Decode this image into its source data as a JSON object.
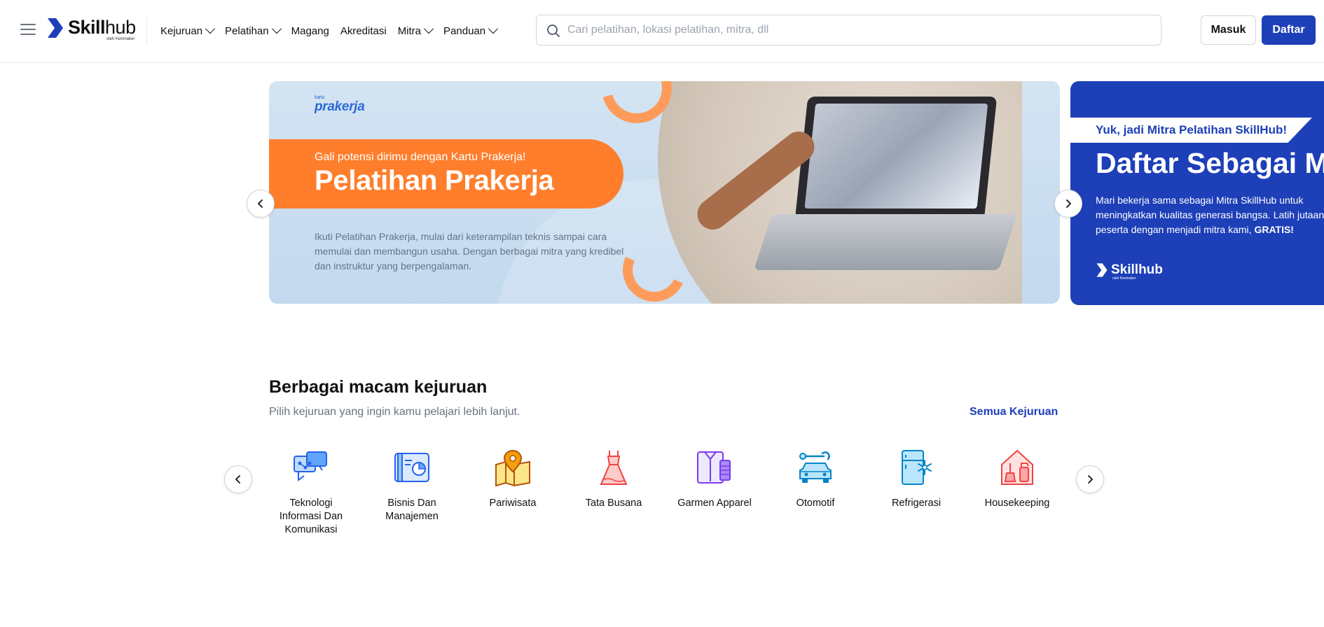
{
  "header": {
    "logo_text_bold": "Skill",
    "logo_text_light": "hub",
    "logo_sub": "oleh Kemnaker",
    "nav": [
      {
        "label": "Kejuruan",
        "dropdown": true
      },
      {
        "label": "Pelatihan",
        "dropdown": true
      },
      {
        "label": "Magang",
        "dropdown": false
      },
      {
        "label": "Akreditasi",
        "dropdown": false
      },
      {
        "label": "Mitra",
        "dropdown": true
      },
      {
        "label": "Panduan",
        "dropdown": true
      }
    ],
    "search_placeholder": "Cari pelatihan, lokasi pelatihan, mitra, dll",
    "login_label": "Masuk",
    "register_label": "Daftar"
  },
  "carousel": {
    "slide1": {
      "logo_top": "kartu",
      "logo_main": "prakerja",
      "eyebrow": "Gali potensi dirimu dengan Kartu Prakerja!",
      "title": "Pelatihan Prakerja",
      "description": "Ikuti Pelatihan Prakerja, mulai dari keterampilan teknis sampai cara memulai dan membangun usaha. Dengan berbagai mitra yang kredibel dan instruktur yang berpengalaman."
    },
    "slide2": {
      "eyebrow": "Yuk, jadi Mitra Pelatihan SkillHub!",
      "title": "Daftar Sebagai Mitra",
      "desc_line1": "Mari bekerja sama sebagai Mitra SkillHub untuk",
      "desc_line2": "meningkatkan kualitas generasi bangsa. Latih jutaan",
      "desc_line3_pre": "peserta dengan menjadi mitra kami, ",
      "desc_line3_bold": "GRATIS!",
      "logo_text": "Skillhub",
      "logo_sub": "oleh Kemnaker"
    }
  },
  "kejuruan": {
    "title": "Berbagai macam kejuruan",
    "subtitle": "Pilih kejuruan yang ingin kamu pelajari lebih lanjut.",
    "see_all": "Semua Kejuruan",
    "categories": [
      {
        "label": "Teknologi Informasi Dan Komunikasi",
        "icon": "chat-network-icon",
        "color": "#2563eb"
      },
      {
        "label": "Bisnis Dan Manajemen",
        "icon": "business-chart-icon",
        "color": "#2563eb"
      },
      {
        "label": "Pariwisata",
        "icon": "map-pin-icon",
        "color": "#d97706"
      },
      {
        "label": "Tata Busana",
        "icon": "dress-icon",
        "color": "#ef4444"
      },
      {
        "label": "Garmen Apparel",
        "icon": "shirt-thread-icon",
        "color": "#7c3aed"
      },
      {
        "label": "Otomotif",
        "icon": "car-wrench-icon",
        "color": "#0284c7"
      },
      {
        "label": "Refrigerasi",
        "icon": "fridge-snow-icon",
        "color": "#0284c7"
      },
      {
        "label": "Housekeeping",
        "icon": "cleaning-house-icon",
        "color": "#ef4444"
      }
    ]
  },
  "colors": {
    "brand": "#1d3fb8",
    "accent_orange": "#ff7e2c"
  }
}
